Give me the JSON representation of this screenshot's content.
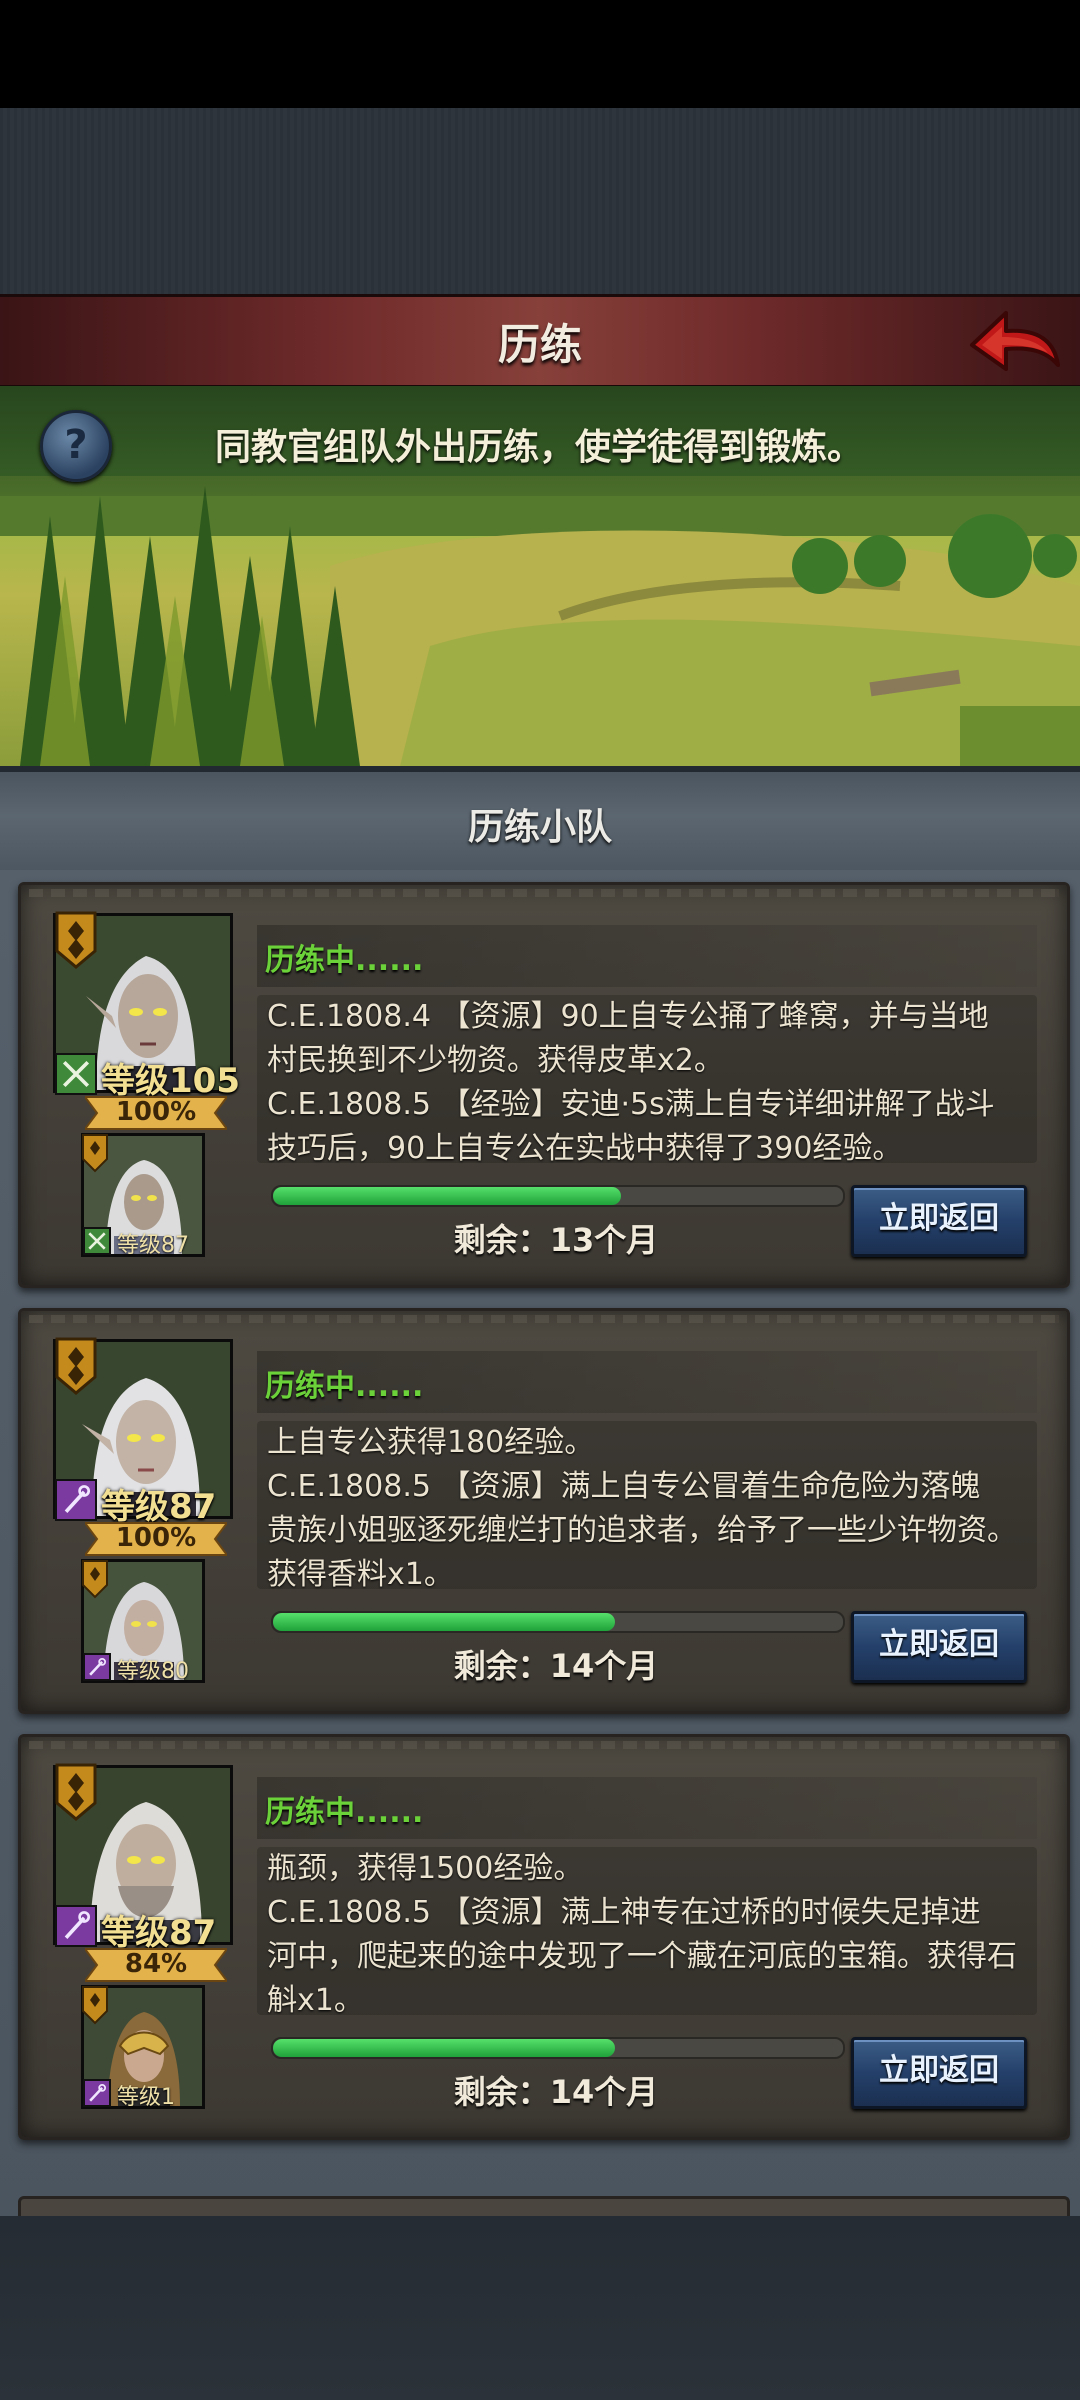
{
  "header": {
    "title": "历练"
  },
  "banner": {
    "caption": "同教官组队外出历练，使学徒得到锻炼。"
  },
  "section": {
    "title": "历练小队"
  },
  "cards": [
    {
      "status": "历练中......",
      "level": "等级105",
      "percent": "100%",
      "mini_level": "等级87",
      "type": "sword",
      "lines": [
        "C.E.1808.4 【资源】90上自专公捅了蜂窝，并与当地",
        "村民换到不少物资。获得皮革x2。",
        "C.E.1808.5 【经验】安迪·5s满上自专详细讲解了战斗",
        "技巧后，90上自专公在实战中获得了390经验。"
      ],
      "progress": 0.61,
      "remaining": "剩余：13个月",
      "button": "立即返回"
    },
    {
      "status": "历练中......",
      "level": "等级87",
      "percent": "100%",
      "mini_level": "等级80",
      "type": "staff",
      "lines": [
        "上自专公获得180经验。",
        "C.E.1808.5 【资源】满上自专公冒着生命危险为落魄",
        "贵族小姐驱逐死缠烂打的追求者，给予了一些少许物资。",
        "获得香料x1。"
      ],
      "progress": 0.6,
      "remaining": "剩余：14个月",
      "button": "立即返回"
    },
    {
      "status": "历练中......",
      "level": "等级87",
      "percent": "84%",
      "mini_level": "等级1",
      "type": "staff",
      "lines": [
        "瓶颈，获得1500经验。",
        "C.E.1808.5 【资源】满上神专在过桥的时候失足掉进",
        "河中，爬起来的途中发现了一个藏在河底的宝箱。获得石",
        "斛x1。"
      ],
      "progress": 0.6,
      "remaining": "剩余：14个月",
      "button": "立即返回"
    }
  ],
  "colors": {
    "status_green": "#6cd23a",
    "progress_green": "#35c24c",
    "button_blue": "#24406a",
    "title_red": "#6e2a2a"
  },
  "icons": {
    "back": "red-back-arrow-icon",
    "help": "question-mark-icon",
    "sword": "crossed-swords-icon",
    "staff": "staff-icon",
    "class": "rank-badge-icon"
  }
}
